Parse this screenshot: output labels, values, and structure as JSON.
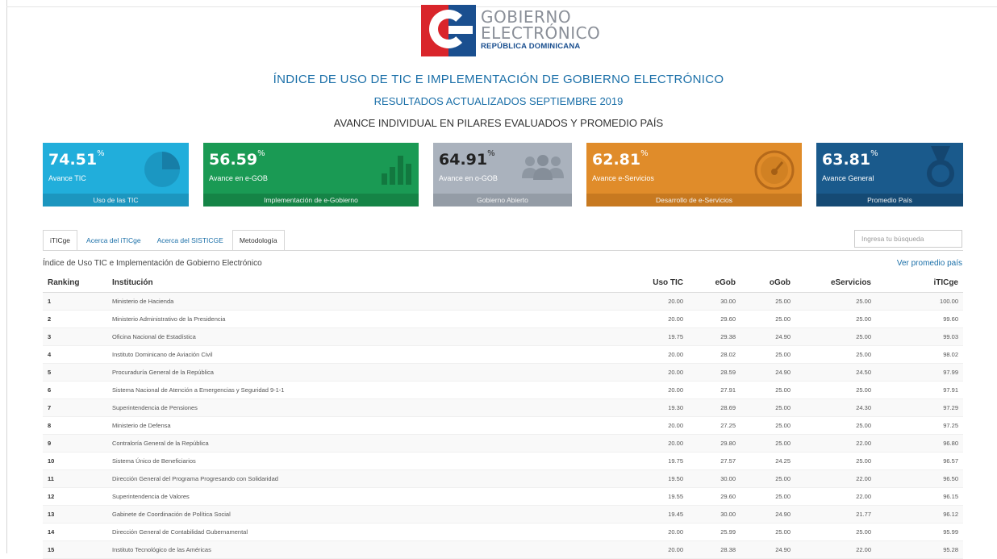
{
  "logo": {
    "line1": "GOBIERNO",
    "line2": "ELECTRÓNICO",
    "line3": "REPÚBLICA DOMINICANA",
    "colors": {
      "red": "#d9252b",
      "blue": "#1a4f8f",
      "gray": "#8a8f98"
    }
  },
  "header": {
    "title": "ÍNDICE DE USO DE TIC E IMPLEMENTACIÓN DE GOBIERNO ELECTRÓNICO",
    "updated": "RESULTADOS ACTUALIZADOS SEPTIEMBRE 2019",
    "section": "AVANCE INDIVIDUAL EN PILARES EVALUADOS Y PROMEDIO PAÍS"
  },
  "cards": [
    {
      "value": "74.51",
      "unit": "%",
      "label": "Avance TIC",
      "footer": "Uso de las TIC",
      "icon": "pie-chart-icon",
      "color": "#21aedb",
      "foot_color": "#1c96bf"
    },
    {
      "value": "56.59",
      "unit": "%",
      "label": "Avance en e-GOB",
      "footer": "Implementación de e-Gobierno",
      "icon": "bar-chart-icon",
      "color": "#1a9a54",
      "foot_color": "#158446"
    },
    {
      "value": "64.91",
      "unit": "%",
      "label": "Avance en o-GOB",
      "footer": "Gobierno Abierto",
      "icon": "people-icon",
      "color": "#aab2bd",
      "foot_color": "#949ca6"
    },
    {
      "value": "62.81",
      "unit": "%",
      "label": "Avance e-Servicios",
      "footer": "Desarrollo de e-Servicios",
      "icon": "speedometer-icon",
      "color": "#e08c2a",
      "foot_color": "#c77920"
    },
    {
      "value": "63.81",
      "unit": "%",
      "label": "Avance General",
      "footer": "Promedio País",
      "icon": "medal-icon",
      "color": "#1a5a8c",
      "foot_color": "#154a74"
    }
  ],
  "tabs": [
    "iTICge",
    "Acerca del iTICge",
    "Acerca del SISTICGE",
    "Metodología"
  ],
  "search": {
    "placeholder": "Ingresa tu búsqueda"
  },
  "table": {
    "subtitle": "Índice de Uso TIC e Implementación de Gobierno Electrónico",
    "link": "Ver promedio país",
    "columns": [
      "Ranking",
      "Institución",
      "Uso TIC",
      "eGob",
      "oGob",
      "eServicios",
      "iTICge"
    ],
    "rows": [
      [
        "1",
        "Ministerio de Hacienda",
        "20.00",
        "30.00",
        "25.00",
        "25.00",
        "100.00"
      ],
      [
        "2",
        "Ministerio Administrativo de la Presidencia",
        "20.00",
        "29.60",
        "25.00",
        "25.00",
        "99.60"
      ],
      [
        "3",
        "Oficina Nacional de Estadística",
        "19.75",
        "29.38",
        "24.90",
        "25.00",
        "99.03"
      ],
      [
        "4",
        "Instituto Dominicano de Aviación Civil",
        "20.00",
        "28.02",
        "25.00",
        "25.00",
        "98.02"
      ],
      [
        "5",
        "Procuraduría General de la República",
        "20.00",
        "28.59",
        "24.90",
        "24.50",
        "97.99"
      ],
      [
        "6",
        "Sistema Nacional de Atención a Emergencias y Seguridad 9-1-1",
        "20.00",
        "27.91",
        "25.00",
        "25.00",
        "97.91"
      ],
      [
        "7",
        "Superintendencia de Pensiones",
        "19.30",
        "28.69",
        "25.00",
        "24.30",
        "97.29"
      ],
      [
        "8",
        "Ministerio de Defensa",
        "20.00",
        "27.25",
        "25.00",
        "25.00",
        "97.25"
      ],
      [
        "9",
        "Contraloría General de la República",
        "20.00",
        "29.80",
        "25.00",
        "22.00",
        "96.80"
      ],
      [
        "10",
        "Sistema Único de Beneficiarios",
        "19.75",
        "27.57",
        "24.25",
        "25.00",
        "96.57"
      ],
      [
        "11",
        "Dirección General del Programa Progresando con Solidaridad",
        "19.50",
        "30.00",
        "25.00",
        "22.00",
        "96.50"
      ],
      [
        "12",
        "Superintendencia de Valores",
        "19.55",
        "29.60",
        "25.00",
        "22.00",
        "96.15"
      ],
      [
        "13",
        "Gabinete de Coordinación de Política Social",
        "19.45",
        "30.00",
        "24.90",
        "21.77",
        "96.12"
      ],
      [
        "14",
        "Dirección General de Contabilidad Gubernamental",
        "20.00",
        "25.99",
        "25.00",
        "25.00",
        "95.99"
      ],
      [
        "15",
        "Instituto Tecnológico de las Américas",
        "20.00",
        "28.38",
        "24.90",
        "22.00",
        "95.28"
      ]
    ]
  }
}
